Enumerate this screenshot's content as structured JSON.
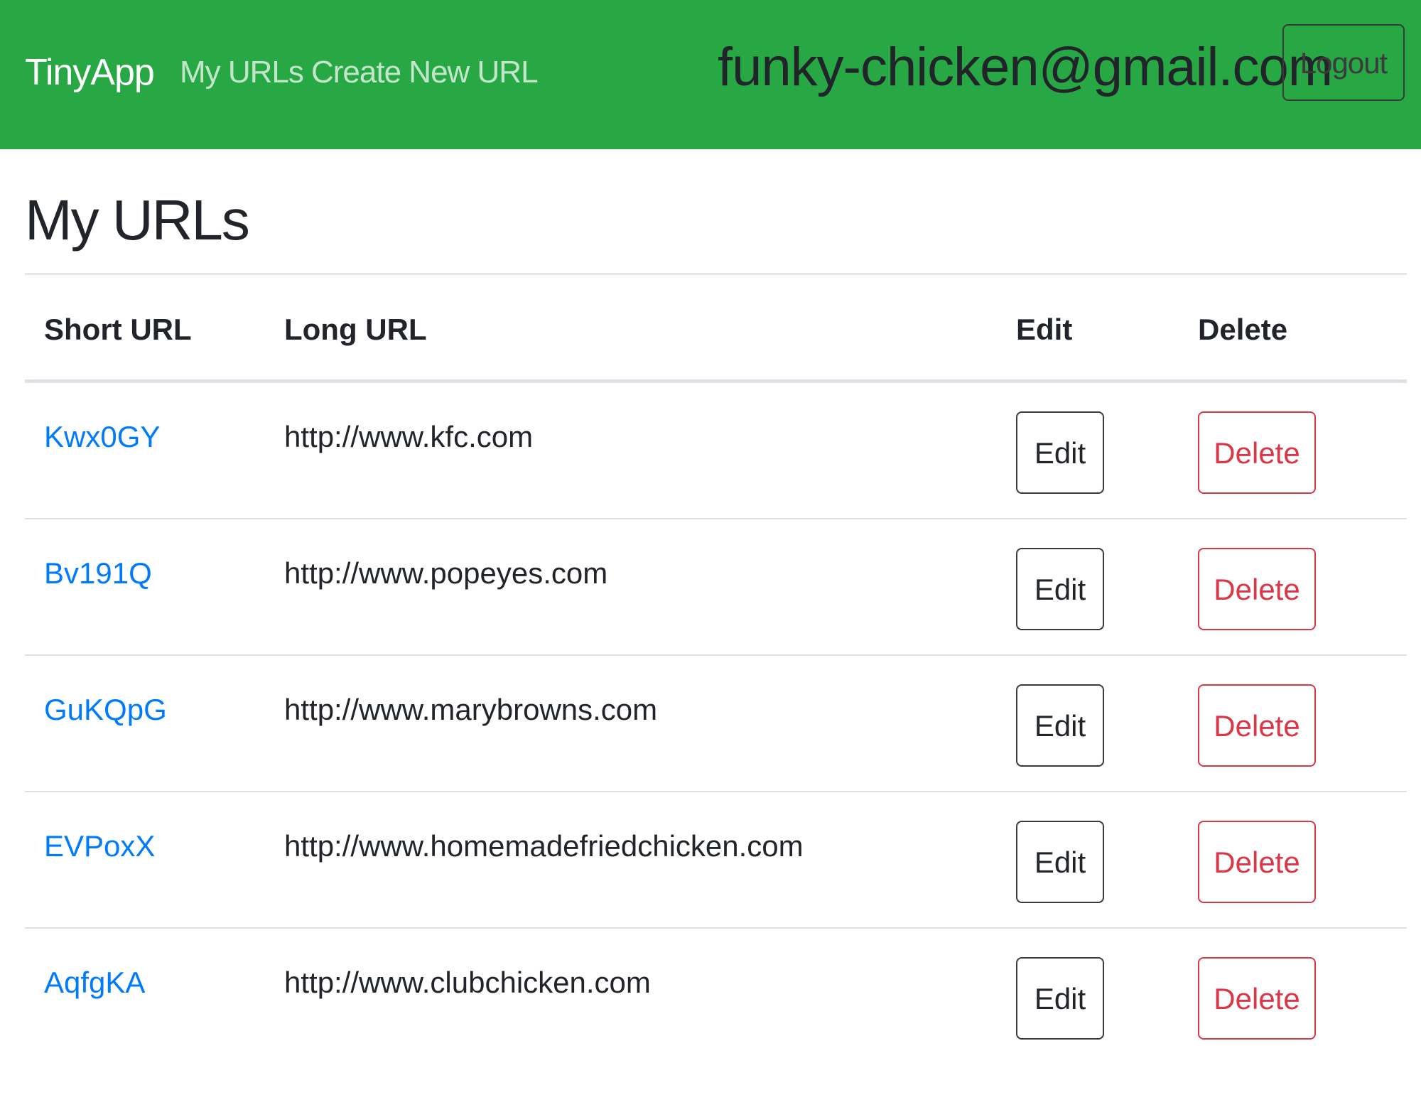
{
  "navbar": {
    "brand": "TinyApp",
    "links": [
      {
        "label": "My URLs"
      },
      {
        "label": "Create New URL"
      }
    ],
    "user_email": "funky-chicken@gmail.com",
    "logout_label": "Logout",
    "background_color": "#28a745"
  },
  "page": {
    "title": "My URLs"
  },
  "table": {
    "headers": {
      "short_url": "Short URL",
      "long_url": "Long URL",
      "edit": "Edit",
      "delete": "Delete"
    },
    "rows": [
      {
        "short_url": "Kwx0GY",
        "long_url": "http://www.kfc.com",
        "edit_label": "Edit",
        "delete_label": "Delete"
      },
      {
        "short_url": "Bv191Q",
        "long_url": "http://www.popeyes.com",
        "edit_label": "Edit",
        "delete_label": "Delete"
      },
      {
        "short_url": "GuKQpG",
        "long_url": "http://www.marybrowns.com",
        "edit_label": "Edit",
        "delete_label": "Delete"
      },
      {
        "short_url": "EVPoxX",
        "long_url": "http://www.homemadefriedchicken.com",
        "edit_label": "Edit",
        "delete_label": "Delete"
      },
      {
        "short_url": "AqfgKA",
        "long_url": "http://www.clubchicken.com",
        "edit_label": "Edit",
        "delete_label": "Delete"
      }
    ]
  },
  "colors": {
    "link": "#007bff",
    "danger": "#dc3545",
    "text": "#212529"
  }
}
